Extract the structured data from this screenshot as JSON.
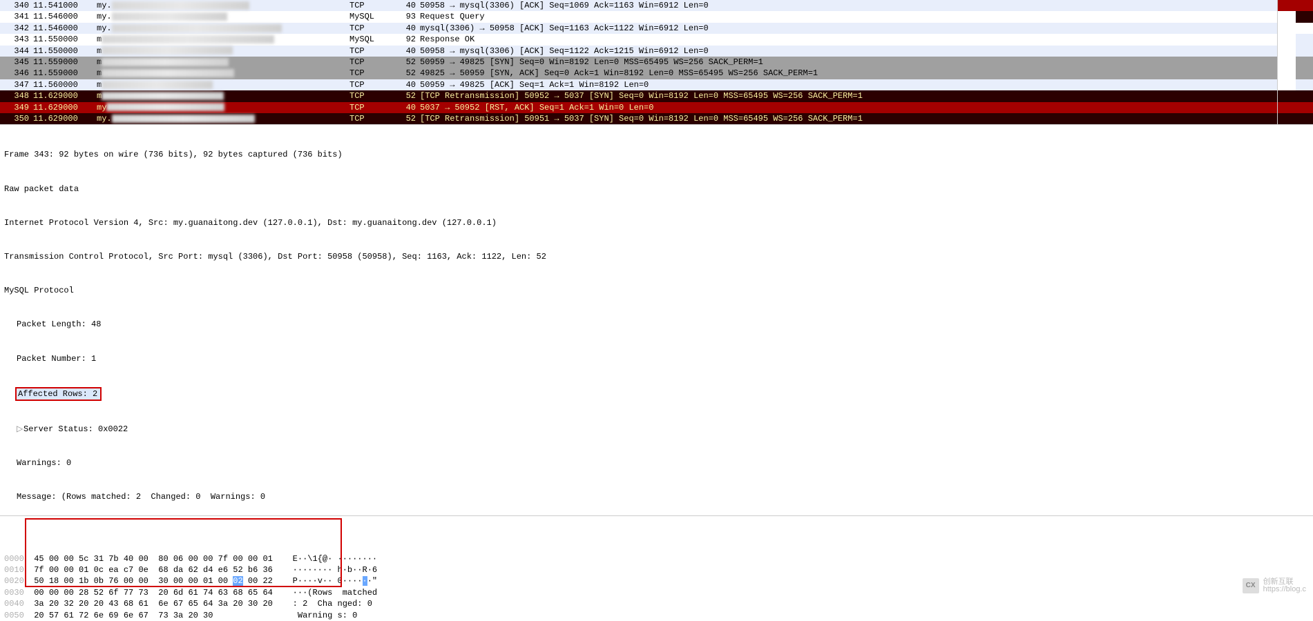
{
  "packets": [
    {
      "no": "340",
      "time": "11.541000",
      "src": "my.",
      "proto": "TCP",
      "len": "40",
      "info": "50958 → mysql(3306) [ACK] Seq=1069 Ack=1163 Win=6912 Len=0",
      "style": "bg-lightblue",
      "mm": [
        "mm-red",
        "mm-red"
      ]
    },
    {
      "no": "341",
      "time": "11.546000",
      "src": "my.",
      "proto": "MySQL",
      "len": "93",
      "info": "Request Query",
      "style": "bg-white",
      "mm": [
        "mm-none",
        "mm-dred"
      ]
    },
    {
      "no": "342",
      "time": "11.546000",
      "src": "my.",
      "proto": "TCP",
      "len": "40",
      "info": "mysql(3306) → 50958 [ACK] Seq=1163 Ack=1122 Win=6912 Len=0",
      "style": "bg-lightblue",
      "mm": [
        "mm-none",
        "mm-none"
      ]
    },
    {
      "no": "343",
      "time": "11.550000",
      "src": "m",
      "proto": "MySQL",
      "len": "92",
      "info": "Response OK",
      "style": "bg-white",
      "mm": [
        "mm-none",
        "mm-lb"
      ]
    },
    {
      "no": "344",
      "time": "11.550000",
      "src": "m",
      "proto": "TCP",
      "len": "40",
      "info": "50958 → mysql(3306) [ACK] Seq=1122 Ack=1215 Win=6912 Len=0",
      "style": "bg-lightblue",
      "mm": [
        "mm-none",
        "mm-lb"
      ]
    },
    {
      "no": "345",
      "time": "11.559000",
      "src": "m",
      "proto": "TCP",
      "len": "52",
      "info": "50959 → 49825 [SYN] Seq=0 Win=8192 Len=0 MSS=65495 WS=256 SACK_PERM=1",
      "style": "bg-grey",
      "mm": [
        "mm-none",
        "mm-grey"
      ]
    },
    {
      "no": "346",
      "time": "11.559000",
      "src": "m",
      "proto": "TCP",
      "len": "52",
      "info": "49825 → 50959 [SYN, ACK] Seq=0 Ack=1 Win=8192 Len=0 MSS=65495 WS=256 SACK_PERM=1",
      "style": "bg-grey",
      "mm": [
        "mm-none",
        "mm-grey"
      ]
    },
    {
      "no": "347",
      "time": "11.560000",
      "src": "m",
      "proto": "TCP",
      "len": "40",
      "info": "50959 → 49825 [ACK] Seq=1 Ack=1 Win=8192 Len=0",
      "style": "bg-lightblue",
      "mm": [
        "mm-none",
        "mm-lb"
      ]
    },
    {
      "no": "348",
      "time": "11.629000",
      "src": "m",
      "proto": "TCP",
      "len": "52",
      "info": "[TCP Retransmission] 50952 → 5037 [SYN] Seq=0 Win=8192 Len=0 MSS=65495 WS=256 SACK_PERM=1",
      "style": "bg-darkred",
      "mm": [
        "mm-dred",
        "mm-dred"
      ]
    },
    {
      "no": "349",
      "time": "11.629000",
      "src": "my",
      "proto": "TCP",
      "len": "40",
      "info": "5037 → 50952 [RST, ACK] Seq=1 Ack=1 Win=0 Len=0",
      "style": "bg-red",
      "mm": [
        "mm-red",
        "mm-red"
      ]
    },
    {
      "no": "350",
      "time": "11.629000",
      "src": "my.",
      "proto": "TCP",
      "len": "52",
      "info": "[TCP Retransmission] 50951 → 5037 [SYN] Seq=0 Win=8192 Len=0 MSS=65495 WS=256 SACK_PERM=1",
      "style": "bg-darkred",
      "mm": [
        "mm-dred",
        "mm-dred"
      ]
    }
  ],
  "details": {
    "frame": "Frame 343: 92 bytes on wire (736 bits), 92 bytes captured (736 bits)",
    "raw": "Raw packet data",
    "ip": "Internet Protocol Version 4, Src: my.guanaitong.dev (127.0.0.1), Dst: my.guanaitong.dev (127.0.0.1)",
    "tcp": "Transmission Control Protocol, Src Port: mysql (3306), Dst Port: 50958 (50958), Seq: 1163, Ack: 1122, Len: 52",
    "mysql": "MySQL Protocol",
    "pkt_len": "Packet Length: 48",
    "pkt_num": "Packet Number: 1",
    "affected": "Affected Rows: 2",
    "server_status": "Server Status: 0x0022",
    "warnings": "Warnings: 0",
    "message": "Message: (Rows matched: 2  Changed: 0  Warnings: 0"
  },
  "hex": {
    "lines": [
      {
        "off": "0000",
        "b1": "45 00 00 5c 31 7b 40 00",
        "b2": "80 06 00 00 7f 00 00 01",
        "asc": "E··\\1{@· ········"
      },
      {
        "off": "0010",
        "b1": "7f 00 00 01 0c ea c7 0e",
        "b2": "68 da 62 d4 e6 52 b6 36",
        "asc": "········ h·b··R·6"
      },
      {
        "off": "0020",
        "b1": "50 18 00 1b 0b 76 00 00",
        "b2": "30 00 00 01 00 ",
        "b2hl": "02",
        "b2post": " 00 22",
        "asc": "P····v·· 0····",
        "aschl": "·",
        "ascpost": "·\""
      },
      {
        "off": "0030",
        "b1": "00 00 00 28 52 6f 77 73",
        "b2": "20 6d 61 74 63 68 65 64",
        "asc": "···(Rows  matched"
      },
      {
        "off": "0040",
        "b1": "3a 20 32 20 20 43 68 61",
        "b2": "6e 67 65 64 3a 20 30 20",
        "asc": ": 2  Cha nged: 0 "
      },
      {
        "off": "0050",
        "b1": "20 57 61 72 6e 69 6e 67",
        "b2": "73 3a 20 30",
        "asc": " Warning s: 0"
      }
    ]
  },
  "watermark": {
    "logo": "CX",
    "text1": "创新互联",
    "text2": "https://blog.c"
  }
}
